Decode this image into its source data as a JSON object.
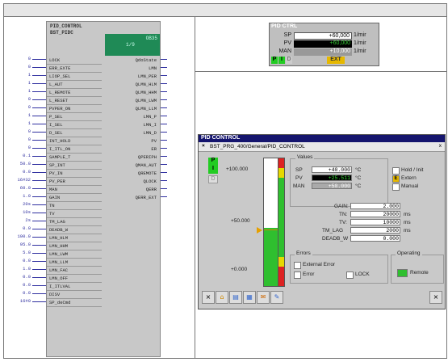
{
  "fb": {
    "title": "PID_CONTROL\nBST_PIDC",
    "green_line1": "OB35",
    "green_line2": "1/9",
    "inputs": [
      {
        "val": "0",
        "name": "LOCK"
      },
      {
        "val": "0",
        "name": "ERR_EXTE"
      },
      {
        "val": "1",
        "name": "LIOP_SEL"
      },
      {
        "val": "1",
        "name": "L_AUT"
      },
      {
        "val": "1",
        "name": "L_REMOTE"
      },
      {
        "val": "0",
        "name": "L_RESET"
      },
      {
        "val": "0",
        "name": "PVPER_ON"
      },
      {
        "val": "1",
        "name": "P_SEL"
      },
      {
        "val": "1",
        "name": "I_SEL"
      },
      {
        "val": "0",
        "name": "D_SEL"
      },
      {
        "val": "0",
        "name": "INT_HOLD"
      },
      {
        "val": "0",
        "name": "I_ITL_ON"
      },
      {
        "val": "0.1",
        "name": "SAMPLE_T"
      },
      {
        "val": "50.0",
        "name": "SP_INT"
      },
      {
        "val": "0.0",
        "name": "PV_IN"
      },
      {
        "val": "16#32",
        "name": "PV_PER"
      },
      {
        "val": "60.0",
        "name": "MAN"
      },
      {
        "val": "1.0",
        "name": "GAIN"
      },
      {
        "val": "20s",
        "name": "TN"
      },
      {
        "val": "10s",
        "name": "TV"
      },
      {
        "val": "2s",
        "name": "TM_LAG"
      },
      {
        "val": "0.0",
        "name": "DEADB_W"
      },
      {
        "val": "100.0",
        "name": "LMN_HLM"
      },
      {
        "val": "95.0",
        "name": "LMN_HHM"
      },
      {
        "val": "5.0",
        "name": "LMN_LWM"
      },
      {
        "val": "0.0",
        "name": "LMN_LLM"
      },
      {
        "val": "1.0",
        "name": "LMN_FAC"
      },
      {
        "val": "0.0",
        "name": "LMN_OFF"
      },
      {
        "val": "0.0",
        "name": "I_ITLVAL"
      },
      {
        "val": "0.0",
        "name": "DISV"
      },
      {
        "val": "16#0",
        "name": "SP_deCmd"
      }
    ],
    "outputs": [
      "QdoState",
      "LMN",
      "LMN_PER",
      "QLMN_HLM",
      "QLMN_HHM",
      "QLMN_LWM",
      "QLMN_LLM",
      "LMN_P",
      "LMN_I",
      "LMN_D",
      "PV",
      "ER",
      "QPERIPH",
      "QMAN_AUT",
      "QREMOTE",
      "QLOCK",
      "QERR",
      "QERR_EXT"
    ]
  },
  "mini": {
    "title": "PID CTRL",
    "rows": [
      {
        "label": "SP",
        "value": "+60,000",
        "unit": "1/mir"
      },
      {
        "label": "PV",
        "value": "+60,000",
        "unit": "1/mir"
      },
      {
        "label": "MAN",
        "value": "+10,000",
        "unit": "1/mir"
      }
    ],
    "p": "P",
    "i": "I",
    "d": "D",
    "ext": "EXT"
  },
  "face": {
    "title": "PID CONTROL",
    "path": "BST_PRG_400/General/PID_CONTROL",
    "p": "P",
    "i": "I",
    "d": "D",
    "scale_top": "+100.000",
    "scale_mid": "+50.000",
    "scale_bot": "+0.000",
    "values_group": "Values",
    "sp_label": "SP",
    "sp_value": "+40.000",
    "sp_unit": "°C",
    "pv_label": "PV",
    "pv_value": "+25.511",
    "pv_unit": "°C",
    "man_label": "MAN",
    "man_value": "+50.000",
    "man_unit": "°C",
    "mode_hold": "Hold / Init",
    "mode_extern": "Extern",
    "mode_extern_mark": "E",
    "mode_manual": "Manual",
    "gain_label": "GAIN:",
    "gain_value": "2.000",
    "tn_label": "TN:",
    "tn_value": "20000",
    "tn_unit": "ms",
    "tv_label": "TV:",
    "tv_value": "10000",
    "tv_unit": "ms",
    "tmlag_label": "TM_LAG",
    "tmlag_value": "2000",
    "tmlag_unit": "ms",
    "deadb_label": "DEADB_W",
    "deadb_value": "0.000",
    "errors_group": "Errors",
    "ext_error": "External Error",
    "error": "Error",
    "lock": "LOCK",
    "operating_group": "Operating",
    "remote": "Remote",
    "close": "x"
  }
}
